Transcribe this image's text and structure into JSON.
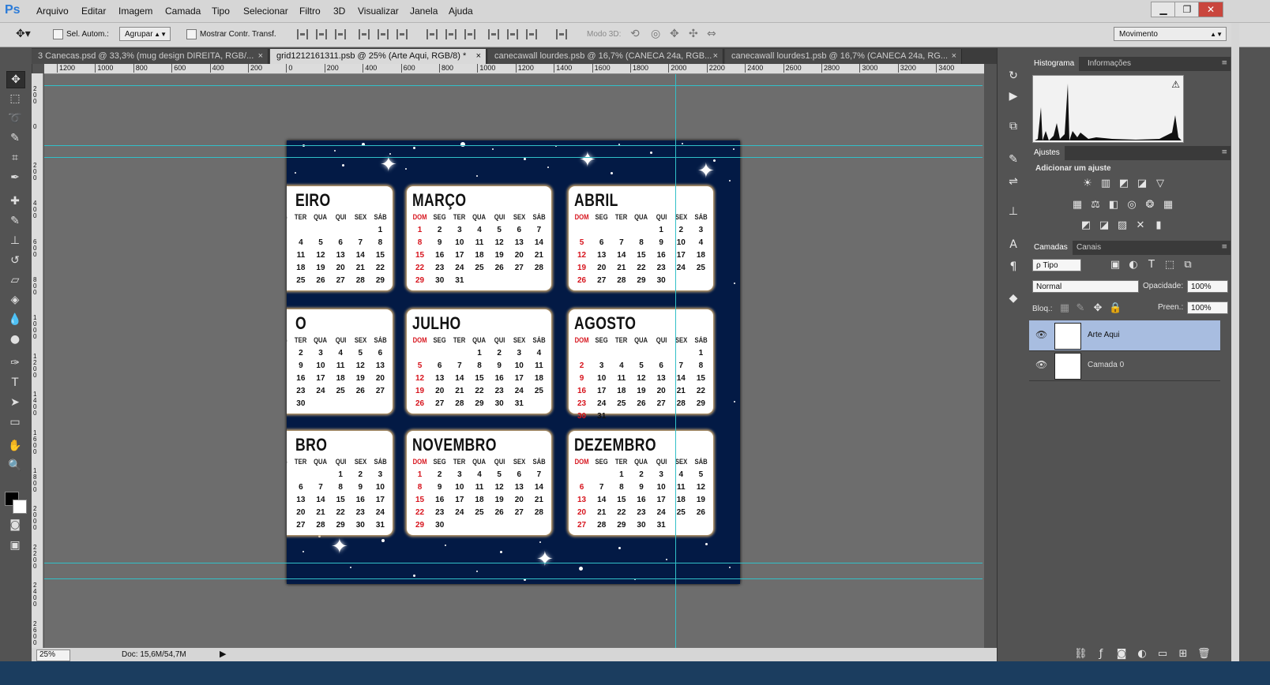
{
  "app": {
    "logo": "Ps"
  },
  "menu": [
    "Arquivo",
    "Editar",
    "Imagem",
    "Camada",
    "Tipo",
    "Selecionar",
    "Filtro",
    "3D",
    "Visualizar",
    "Janela",
    "Ajuda"
  ],
  "window_controls": {
    "minimize": "▁",
    "restore": "❐",
    "close": "✕"
  },
  "options": {
    "auto_select_label": "Sel. Autom.:",
    "auto_select_value": "Agrupar",
    "show_transform_label": "Mostrar Contr. Transf.",
    "mode3d_label": "Modo 3D:",
    "workspace_value": "Movimento"
  },
  "tabs": [
    {
      "label": "3 Canecas.psd @ 33,3% (mug design DIREITA, RGB/...",
      "close": "×"
    },
    {
      "label": "grid1212161311.psb @ 25% (Arte Aqui, RGB/8) *",
      "close": "×"
    },
    {
      "label": "canecawall lourdes.psb @ 16,7% (CANECA 24a, RGB...",
      "close": "×"
    },
    {
      "label": "canecawall lourdes1.psb @ 16,7% (CANECA 24a, RG...",
      "close": "×"
    }
  ],
  "ruler_top": [
    "1200",
    "1000",
    "800",
    "600",
    "400",
    "200",
    "0",
    "200",
    "400",
    "600",
    "800",
    "1000",
    "1200",
    "1400",
    "1600",
    "1800",
    "2000",
    "2200",
    "2400",
    "2600",
    "2800",
    "3000",
    "3200",
    "3400"
  ],
  "ruler_left": [
    "200",
    "0",
    "200",
    "400",
    "600",
    "800",
    "1000",
    "1200",
    "1400",
    "1600",
    "1800",
    "2000",
    "2200",
    "2400",
    "2600"
  ],
  "calendar": {
    "day_headers": [
      "DOM",
      "SEG",
      "TER",
      "QUA",
      "QUI",
      "SEX",
      "SÁB"
    ],
    "months": [
      {
        "name": "EIRO",
        "weeks": [
          [
            "",
            "",
            "",
            "",
            "",
            "",
            "1"
          ],
          [
            "",
            "",
            "4",
            "5",
            "6",
            "7",
            "8"
          ],
          [
            "",
            "",
            "11",
            "12",
            "13",
            "14",
            "15"
          ],
          [
            "",
            "",
            "18",
            "19",
            "20",
            "21",
            "22"
          ],
          [
            "",
            "",
            "25",
            "26",
            "27",
            "28",
            "29"
          ]
        ]
      },
      {
        "name": "MARÇO",
        "weeks": [
          [
            "1",
            "2",
            "3",
            "4",
            "5",
            "6",
            "7"
          ],
          [
            "8",
            "9",
            "10",
            "11",
            "12",
            "13",
            "14"
          ],
          [
            "15",
            "16",
            "17",
            "18",
            "19",
            "20",
            "21"
          ],
          [
            "22",
            "23",
            "24",
            "25",
            "26",
            "27",
            "28"
          ],
          [
            "29",
            "30",
            "31",
            "",
            "",
            "",
            ""
          ]
        ]
      },
      {
        "name": "ABRIL",
        "weeks": [
          [
            "",
            "",
            "",
            "",
            "1",
            "2",
            "3"
          ],
          [
            "5",
            "6",
            "7",
            "8",
            "9",
            "10",
            "4"
          ],
          [
            "12",
            "13",
            "14",
            "15",
            "16",
            "17",
            "18"
          ],
          [
            "19",
            "20",
            "21",
            "22",
            "23",
            "24",
            "25"
          ],
          [
            "26",
            "27",
            "28",
            "29",
            "30",
            "",
            ""
          ]
        ]
      },
      {
        "name": "O",
        "weeks": [
          [
            "",
            "",
            "2",
            "3",
            "4",
            "5",
            "6"
          ],
          [
            "",
            "",
            "9",
            "10",
            "11",
            "12",
            "13"
          ],
          [
            "",
            "",
            "16",
            "17",
            "18",
            "19",
            "20"
          ],
          [
            "",
            "",
            "23",
            "24",
            "25",
            "26",
            "27"
          ],
          [
            "",
            "",
            "30",
            "",
            "",
            "",
            ""
          ]
        ]
      },
      {
        "name": "JULHO",
        "weeks": [
          [
            "",
            "",
            "",
            "1",
            "2",
            "3",
            "4"
          ],
          [
            "5",
            "6",
            "7",
            "8",
            "9",
            "10",
            "11"
          ],
          [
            "12",
            "13",
            "14",
            "15",
            "16",
            "17",
            "18"
          ],
          [
            "19",
            "20",
            "21",
            "22",
            "23",
            "24",
            "25"
          ],
          [
            "26",
            "27",
            "28",
            "29",
            "30",
            "31",
            ""
          ]
        ]
      },
      {
        "name": "AGOSTO",
        "weeks": [
          [
            "",
            "",
            "",
            "",
            "",
            "",
            "1"
          ],
          [
            "2",
            "3",
            "4",
            "5",
            "6",
            "7",
            "8"
          ],
          [
            "9",
            "10",
            "11",
            "12",
            "13",
            "14",
            "15"
          ],
          [
            "16",
            "17",
            "18",
            "19",
            "20",
            "21",
            "22"
          ],
          [
            "23",
            "24",
            "25",
            "26",
            "27",
            "28",
            "29"
          ],
          [
            "30",
            "31",
            "",
            "",
            "",
            "",
            ""
          ]
        ]
      },
      {
        "name": "BRO",
        "weeks": [
          [
            "",
            "",
            "",
            "",
            "1",
            "2",
            "3"
          ],
          [
            "",
            "",
            "6",
            "7",
            "8",
            "9",
            "10"
          ],
          [
            "",
            "",
            "13",
            "14",
            "15",
            "16",
            "17"
          ],
          [
            "",
            "",
            "20",
            "21",
            "22",
            "23",
            "24"
          ],
          [
            "",
            "",
            "27",
            "28",
            "29",
            "30",
            "31"
          ]
        ]
      },
      {
        "name": "NOVEMBRO",
        "weeks": [
          [
            "1",
            "2",
            "3",
            "4",
            "5",
            "6",
            "7"
          ],
          [
            "8",
            "9",
            "10",
            "11",
            "12",
            "13",
            "14"
          ],
          [
            "15",
            "16",
            "17",
            "18",
            "19",
            "20",
            "21"
          ],
          [
            "22",
            "23",
            "24",
            "25",
            "26",
            "27",
            "28"
          ],
          [
            "29",
            "30",
            "",
            "",
            "",
            "",
            ""
          ]
        ]
      },
      {
        "name": "DEZEMBRO",
        "weeks": [
          [
            "",
            "",
            "1",
            "2",
            "3",
            "4",
            "5"
          ],
          [
            "6",
            "7",
            "8",
            "9",
            "10",
            "11",
            "12"
          ],
          [
            "13",
            "14",
            "15",
            "16",
            "17",
            "18",
            "19"
          ],
          [
            "20",
            "21",
            "22",
            "23",
            "24",
            "25",
            "26"
          ],
          [
            "27",
            "28",
            "29",
            "30",
            "31",
            "",
            ""
          ]
        ]
      }
    ]
  },
  "status": {
    "zoom": "25%",
    "doc": "Doc: 15,6M/54,7M"
  },
  "panels": {
    "histogram_tabs": [
      "Histograma",
      "Informações"
    ],
    "histogram_warning": "⚠",
    "adjust_tab": "Ajustes",
    "adjust_title": "Adicionar um ajuste",
    "layers_tabs": [
      "Camadas",
      "Canais"
    ],
    "filter_value": "ρ Tipo",
    "blend_mode": "Normal",
    "opacity_label": "Opacidade:",
    "opacity_value": "100%",
    "lock_label": "Bloq.:",
    "fill_label": "Preen.:",
    "fill_value": "100%",
    "layers": [
      {
        "name": "Arte Aqui",
        "selected": true
      },
      {
        "name": "Camada 0",
        "selected": false
      }
    ]
  },
  "colors": {
    "accent": "#2b7bd8",
    "guide": "#31c0c8",
    "calendar_bg": "#031a45",
    "sunday": "#d7141d"
  }
}
